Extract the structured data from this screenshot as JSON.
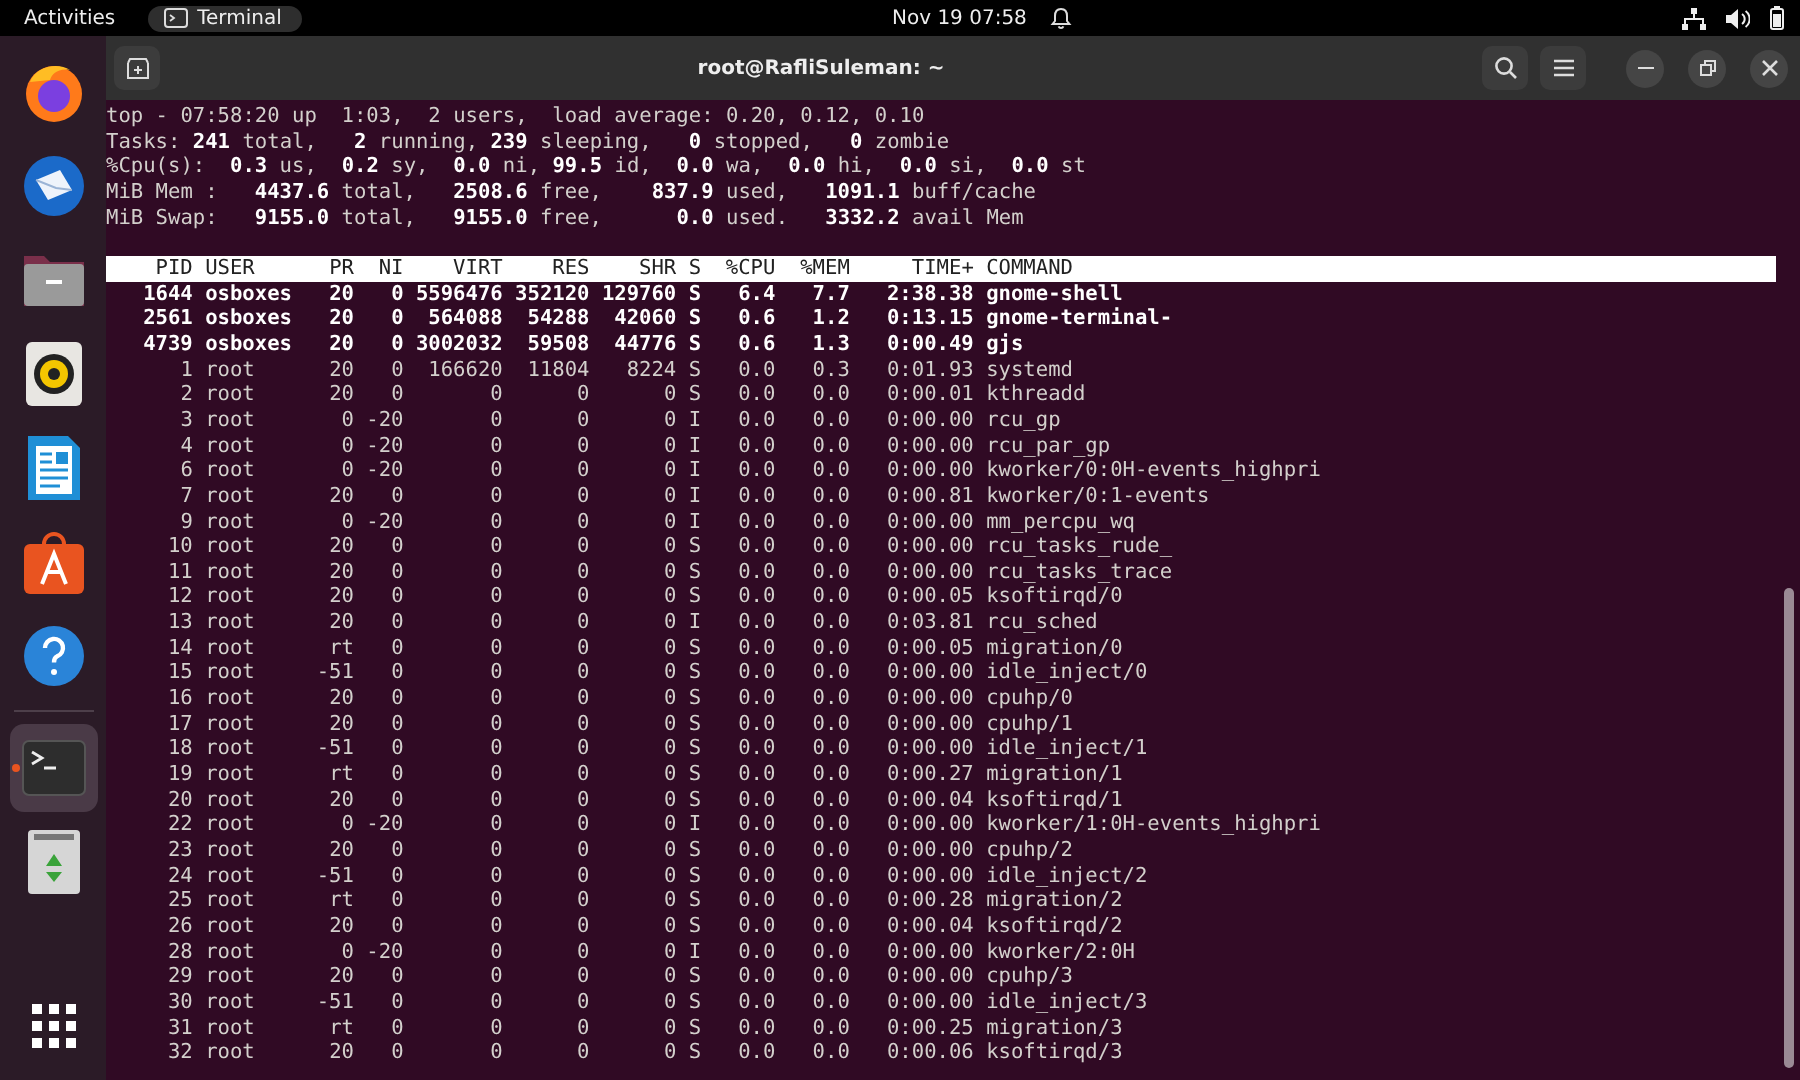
{
  "top_bar": {
    "activities": "Activities",
    "app": "Terminal",
    "clock": "Nov 19  07:58"
  },
  "dock": {
    "items": [
      {
        "kind": "firefox",
        "selected": false
      },
      {
        "kind": "mail",
        "selected": false
      },
      {
        "kind": "files",
        "selected": false
      },
      {
        "kind": "speaker",
        "selected": false
      },
      {
        "kind": "writer",
        "selected": false
      },
      {
        "kind": "store",
        "selected": false
      },
      {
        "kind": "help",
        "selected": false
      },
      {
        "kind": "terminal",
        "selected": true
      },
      {
        "kind": "trash",
        "selected": false
      }
    ]
  },
  "window": {
    "title": "root@RafliSuleman: ~"
  },
  "summary": [
    "top - 07:58:20 up  1:03,  2 users,  load average: 0.20, 0.12, 0.10",
    "Tasks: **241** total,   **2** running, **239** sleeping,   **0** stopped,   **0** zombie",
    "%Cpu(s):  **0.3** us,  **0.2** sy,  **0.0** ni, **99.5** id,  **0.0** wa,  **0.0** hi,  **0.0** si,  **0.0** st",
    "MiB Mem :   **4437.6** total,   **2508.6** free,    **837.9** used,   **1091.1** buff/cache",
    "MiB Swap:   **9155.0** total,   **9155.0** free,      **0.0** used.   **3332.2** avail Mem"
  ],
  "table": {
    "columns": [
      "PID",
      "USER",
      "PR",
      "NI",
      "VIRT",
      "RES",
      "SHR",
      "S",
      "%CPU",
      "%MEM",
      "TIME+",
      "COMMAND"
    ],
    "rows": [
      {
        "bold": true,
        "cells": [
          "1644",
          "osboxes",
          "20",
          "0",
          "5596476",
          "352120",
          "129760",
          "S",
          "6.4",
          "7.7",
          "2:38.38",
          "gnome-shell"
        ]
      },
      {
        "bold": true,
        "cells": [
          "2561",
          "osboxes",
          "20",
          "0",
          "564088",
          "54288",
          "42060",
          "S",
          "0.6",
          "1.2",
          "0:13.15",
          "gnome-terminal-"
        ]
      },
      {
        "bold": true,
        "cells": [
          "4739",
          "osboxes",
          "20",
          "0",
          "3002032",
          "59508",
          "44776",
          "S",
          "0.6",
          "1.3",
          "0:00.49",
          "gjs"
        ]
      },
      {
        "bold": false,
        "cells": [
          "1",
          "root",
          "20",
          "0",
          "166620",
          "11804",
          "8224",
          "S",
          "0.0",
          "0.3",
          "0:01.93",
          "systemd"
        ]
      },
      {
        "bold": false,
        "cells": [
          "2",
          "root",
          "20",
          "0",
          "0",
          "0",
          "0",
          "S",
          "0.0",
          "0.0",
          "0:00.01",
          "kthreadd"
        ]
      },
      {
        "bold": false,
        "cells": [
          "3",
          "root",
          "0",
          "-20",
          "0",
          "0",
          "0",
          "I",
          "0.0",
          "0.0",
          "0:00.00",
          "rcu_gp"
        ]
      },
      {
        "bold": false,
        "cells": [
          "4",
          "root",
          "0",
          "-20",
          "0",
          "0",
          "0",
          "I",
          "0.0",
          "0.0",
          "0:00.00",
          "rcu_par_gp"
        ]
      },
      {
        "bold": false,
        "cells": [
          "6",
          "root",
          "0",
          "-20",
          "0",
          "0",
          "0",
          "I",
          "0.0",
          "0.0",
          "0:00.00",
          "kworker/0:0H-events_highpri"
        ]
      },
      {
        "bold": false,
        "cells": [
          "7",
          "root",
          "20",
          "0",
          "0",
          "0",
          "0",
          "I",
          "0.0",
          "0.0",
          "0:00.81",
          "kworker/0:1-events"
        ]
      },
      {
        "bold": false,
        "cells": [
          "9",
          "root",
          "0",
          "-20",
          "0",
          "0",
          "0",
          "I",
          "0.0",
          "0.0",
          "0:00.00",
          "mm_percpu_wq"
        ]
      },
      {
        "bold": false,
        "cells": [
          "10",
          "root",
          "20",
          "0",
          "0",
          "0",
          "0",
          "S",
          "0.0",
          "0.0",
          "0:00.00",
          "rcu_tasks_rude_"
        ]
      },
      {
        "bold": false,
        "cells": [
          "11",
          "root",
          "20",
          "0",
          "0",
          "0",
          "0",
          "S",
          "0.0",
          "0.0",
          "0:00.00",
          "rcu_tasks_trace"
        ]
      },
      {
        "bold": false,
        "cells": [
          "12",
          "root",
          "20",
          "0",
          "0",
          "0",
          "0",
          "S",
          "0.0",
          "0.0",
          "0:00.05",
          "ksoftirqd/0"
        ]
      },
      {
        "bold": false,
        "cells": [
          "13",
          "root",
          "20",
          "0",
          "0",
          "0",
          "0",
          "I",
          "0.0",
          "0.0",
          "0:03.81",
          "rcu_sched"
        ]
      },
      {
        "bold": false,
        "cells": [
          "14",
          "root",
          "rt",
          "0",
          "0",
          "0",
          "0",
          "S",
          "0.0",
          "0.0",
          "0:00.05",
          "migration/0"
        ]
      },
      {
        "bold": false,
        "cells": [
          "15",
          "root",
          "-51",
          "0",
          "0",
          "0",
          "0",
          "S",
          "0.0",
          "0.0",
          "0:00.00",
          "idle_inject/0"
        ]
      },
      {
        "bold": false,
        "cells": [
          "16",
          "root",
          "20",
          "0",
          "0",
          "0",
          "0",
          "S",
          "0.0",
          "0.0",
          "0:00.00",
          "cpuhp/0"
        ]
      },
      {
        "bold": false,
        "cells": [
          "17",
          "root",
          "20",
          "0",
          "0",
          "0",
          "0",
          "S",
          "0.0",
          "0.0",
          "0:00.00",
          "cpuhp/1"
        ]
      },
      {
        "bold": false,
        "cells": [
          "18",
          "root",
          "-51",
          "0",
          "0",
          "0",
          "0",
          "S",
          "0.0",
          "0.0",
          "0:00.00",
          "idle_inject/1"
        ]
      },
      {
        "bold": false,
        "cells": [
          "19",
          "root",
          "rt",
          "0",
          "0",
          "0",
          "0",
          "S",
          "0.0",
          "0.0",
          "0:00.27",
          "migration/1"
        ]
      },
      {
        "bold": false,
        "cells": [
          "20",
          "root",
          "20",
          "0",
          "0",
          "0",
          "0",
          "S",
          "0.0",
          "0.0",
          "0:00.04",
          "ksoftirqd/1"
        ]
      },
      {
        "bold": false,
        "cells": [
          "22",
          "root",
          "0",
          "-20",
          "0",
          "0",
          "0",
          "I",
          "0.0",
          "0.0",
          "0:00.00",
          "kworker/1:0H-events_highpri"
        ]
      },
      {
        "bold": false,
        "cells": [
          "23",
          "root",
          "20",
          "0",
          "0",
          "0",
          "0",
          "S",
          "0.0",
          "0.0",
          "0:00.00",
          "cpuhp/2"
        ]
      },
      {
        "bold": false,
        "cells": [
          "24",
          "root",
          "-51",
          "0",
          "0",
          "0",
          "0",
          "S",
          "0.0",
          "0.0",
          "0:00.00",
          "idle_inject/2"
        ]
      },
      {
        "bold": false,
        "cells": [
          "25",
          "root",
          "rt",
          "0",
          "0",
          "0",
          "0",
          "S",
          "0.0",
          "0.0",
          "0:00.28",
          "migration/2"
        ]
      },
      {
        "bold": false,
        "cells": [
          "26",
          "root",
          "20",
          "0",
          "0",
          "0",
          "0",
          "S",
          "0.0",
          "0.0",
          "0:00.04",
          "ksoftirqd/2"
        ]
      },
      {
        "bold": false,
        "cells": [
          "28",
          "root",
          "0",
          "-20",
          "0",
          "0",
          "0",
          "I",
          "0.0",
          "0.0",
          "0:00.00",
          "kworker/2:0H"
        ]
      },
      {
        "bold": false,
        "cells": [
          "29",
          "root",
          "20",
          "0",
          "0",
          "0",
          "0",
          "S",
          "0.0",
          "0.0",
          "0:00.00",
          "cpuhp/3"
        ]
      },
      {
        "bold": false,
        "cells": [
          "30",
          "root",
          "-51",
          "0",
          "0",
          "0",
          "0",
          "S",
          "0.0",
          "0.0",
          "0:00.00",
          "idle_inject/3"
        ]
      },
      {
        "bold": false,
        "cells": [
          "31",
          "root",
          "rt",
          "0",
          "0",
          "0",
          "0",
          "S",
          "0.0",
          "0.0",
          "0:00.25",
          "migration/3"
        ]
      },
      {
        "bold": false,
        "cells": [
          "32",
          "root",
          "20",
          "0",
          "0",
          "0",
          "0",
          "S",
          "0.0",
          "0.0",
          "0:00.06",
          "ksoftirqd/3"
        ]
      }
    ]
  }
}
